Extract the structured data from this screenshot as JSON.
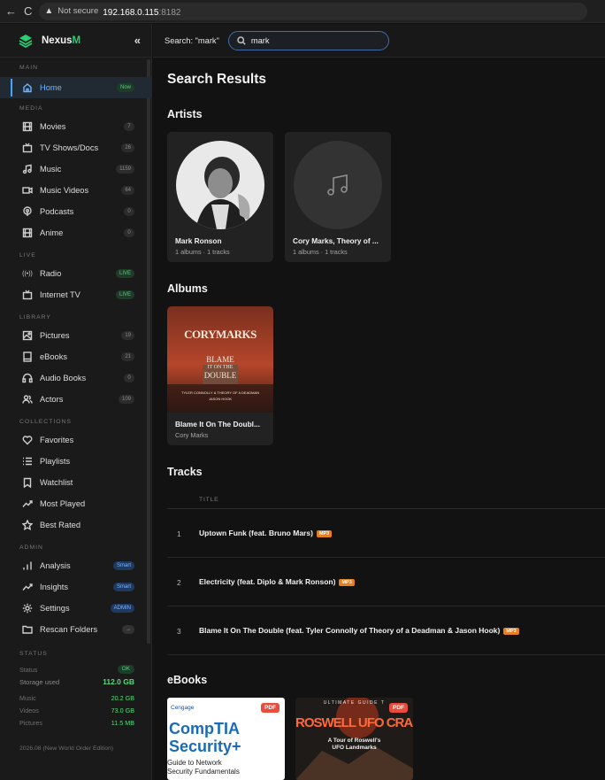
{
  "browser": {
    "not_secure": "Not secure",
    "url_host": "192.168.0.115",
    "url_port": ":8182"
  },
  "brand": {
    "name_a": "Nexus",
    "name_b": "M",
    "collapse": "«",
    "accent": "#2ecc71"
  },
  "sidebar": {
    "main_header": "MAIN",
    "main": [
      {
        "label": "Home",
        "badge": "Now",
        "icon": "home-icon"
      }
    ],
    "media_header": "MEDIA",
    "media": [
      {
        "label": "Movies",
        "badge": "7",
        "icon": "film-icon"
      },
      {
        "label": "TV Shows/Docs",
        "badge": "26",
        "icon": "tv-icon"
      },
      {
        "label": "Music",
        "badge": "1159",
        "icon": "music-note-icon"
      },
      {
        "label": "Music Videos",
        "badge": "64",
        "icon": "video-camera-icon"
      },
      {
        "label": "Podcasts",
        "badge": "0",
        "icon": "podcast-icon"
      },
      {
        "label": "Anime",
        "badge": "0",
        "icon": "film-icon"
      }
    ],
    "live_header": "LIVE",
    "live": [
      {
        "label": "Radio",
        "badge": "LIVE",
        "icon": "radio-waves-icon"
      },
      {
        "label": "Internet TV",
        "badge": "LIVE",
        "icon": "tv-icon"
      }
    ],
    "library_header": "LIBRARY",
    "library": [
      {
        "label": "Pictures",
        "badge": "19",
        "icon": "image-icon"
      },
      {
        "label": "eBooks",
        "badge": "21",
        "icon": "book-icon"
      },
      {
        "label": "Audio Books",
        "badge": "0",
        "icon": "headphones-icon"
      },
      {
        "label": "Actors",
        "badge": "109",
        "icon": "users-icon"
      }
    ],
    "collections_header": "COLLECTIONS",
    "collections": [
      {
        "label": "Favorites",
        "icon": "heart-icon"
      },
      {
        "label": "Playlists",
        "icon": "list-icon"
      },
      {
        "label": "Watchlist",
        "icon": "bookmark-icon"
      },
      {
        "label": "Most Played",
        "icon": "trending-icon"
      },
      {
        "label": "Best Rated",
        "icon": "star-icon"
      }
    ],
    "admin_header": "ADMIN",
    "admin": [
      {
        "label": "Analysis",
        "badge": "Smart",
        "icon": "bar-chart-icon"
      },
      {
        "label": "Insights",
        "badge": "Smart",
        "icon": "trending-icon"
      },
      {
        "label": "Settings",
        "badge": "ADMIN",
        "icon": "gear-icon"
      },
      {
        "label": "Rescan Folders",
        "badge": "→",
        "icon": "folder-icon"
      }
    ],
    "status_header": "STATUS",
    "status": {
      "status_label": "Status",
      "status_value": "OK",
      "storage_label": "Storage used",
      "storage_value": "112.0 GB",
      "music_label": "Music",
      "music_value": "20.2 GB",
      "videos_label": "Videos",
      "videos_value": "73.0 GB",
      "pictures_label": "Pictures",
      "pictures_value": "11.5 MB"
    },
    "version": "2026.08 (New World Order Edition)"
  },
  "search": {
    "label": "Search: \"mark\"",
    "value": "mark"
  },
  "main": {
    "title": "Search Results",
    "artists_title": "Artists",
    "artists": [
      {
        "name": "Mark Ronson",
        "meta": "1 albums · 1 tracks"
      },
      {
        "name": "Cory Marks, Theory of ...",
        "meta": "1 albums · 1 tracks"
      }
    ],
    "albums_title": "Albums",
    "albums": [
      {
        "name": "Blame It On The Doubl...",
        "artist": "Cory Marks",
        "art": {
          "band": "CORYMARKS",
          "line1": "BLAME",
          "line2": "IT ON THE",
          "line3": "DOUBLE",
          "credits": "TYLER CONNOLLY & THEORY OF A DEADMAN",
          "credits2": "JASON HOOK"
        }
      }
    ],
    "tracks_title": "Tracks",
    "tracks_col": "TITLE",
    "tracks": [
      {
        "num": "1",
        "title": "Uptown Funk (feat. Bruno Mars)",
        "format": "MP3"
      },
      {
        "num": "2",
        "title": "Electricity (feat. Diplo & Mark Ronson)",
        "format": "MP3"
      },
      {
        "num": "3",
        "title": "Blame It On The Double (feat. Tyler Connolly of Theory of a Deadman & Jason Hook)",
        "format": "MP3"
      }
    ],
    "ebooks_title": "eBooks",
    "ebooks": [
      {
        "publisher": "Cengage",
        "title1": "CompTIA",
        "title2": "Security+",
        "sub1": "Guide to Network",
        "sub2": "Security Fundamentals",
        "format": "PDF"
      },
      {
        "series": "ULTIMATE GUIDE T",
        "title": "ROSWELL UFO CRASH",
        "sub1": "A Tour of Roswell's",
        "sub2": "UFO Landmarks",
        "format": "PDF"
      }
    ]
  }
}
